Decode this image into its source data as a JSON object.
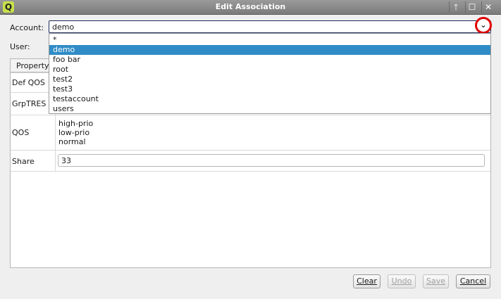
{
  "window": {
    "title": "Edit Association",
    "icon_label": "Q",
    "btn_up": "🡑",
    "btn_max": "☐",
    "btn_close": "✕"
  },
  "form": {
    "account_label": "Account:",
    "account_value": "demo",
    "user_label": "User:",
    "arrow_glyph": "⌄"
  },
  "dropdown": {
    "items": [
      "*",
      "demo",
      "foo bar",
      "root",
      "test2",
      "test3",
      "testaccount",
      "users"
    ],
    "selected": "demo"
  },
  "table": {
    "tab_label": "Property",
    "rows": {
      "def_qos": "Def QOS",
      "grptres": "GrpTRES",
      "qos": "QOS",
      "share": "Share"
    },
    "qos_values": [
      "high-prio",
      "low-prio",
      "normal"
    ],
    "share_value": "33"
  },
  "buttons": {
    "clear": {
      "label": "Clear",
      "enabled": true
    },
    "undo": {
      "label": "Undo",
      "enabled": false
    },
    "save": {
      "label": "Save",
      "enabled": false
    },
    "cancel": {
      "label": "Cancel",
      "enabled": true
    }
  },
  "colors": {
    "selection": "#308cc6",
    "highlight_circle": "#e00000",
    "titlebar": "#8a8a8a"
  }
}
